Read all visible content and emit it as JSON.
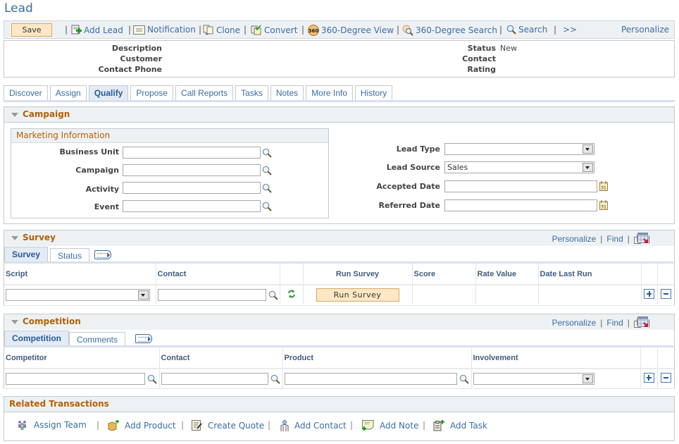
{
  "page_title": "Lead",
  "toolbar": {
    "save_label": "Save",
    "items": [
      {
        "label": "Add Lead",
        "icon": "add-lead-icon"
      },
      {
        "label": "Notification",
        "icon": "notification-icon"
      },
      {
        "label": "Clone",
        "icon": "clone-icon"
      },
      {
        "label": "Convert",
        "icon": "convert-icon"
      },
      {
        "label": "360-Degree View",
        "icon": "360-view-icon"
      },
      {
        "label": "360-Degree Search",
        "icon": "360-search-icon"
      },
      {
        "label": "Search",
        "icon": "search-icon"
      }
    ],
    "more_label": ">>",
    "personalize_label": "Personalize"
  },
  "header": {
    "description_label": "Description",
    "customer_label": "Customer",
    "contact_phone_label": "Contact Phone",
    "status_label": "Status",
    "status_value": "New",
    "contact_label": "Contact",
    "rating_label": "Rating"
  },
  "tabs": [
    {
      "label": "Discover",
      "active": false
    },
    {
      "label": "Assign",
      "active": false
    },
    {
      "label": "Qualify",
      "active": true
    },
    {
      "label": "Propose",
      "active": false
    },
    {
      "label": "Call Reports",
      "active": false
    },
    {
      "label": "Tasks",
      "active": false
    },
    {
      "label": "Notes",
      "active": false
    },
    {
      "label": "More Info",
      "active": false
    },
    {
      "label": "History",
      "active": false
    }
  ],
  "campaign": {
    "title": "Campaign",
    "marketing_title": "Marketing Information",
    "business_unit_label": "Business Unit",
    "business_unit_value": "",
    "campaign_label": "Campaign",
    "campaign_value": "",
    "activity_label": "Activity",
    "activity_value": "",
    "event_label": "Event",
    "event_value": "",
    "lead_type_label": "Lead Type",
    "lead_type_value": "",
    "lead_source_label": "Lead Source",
    "lead_source_value": "Sales",
    "accepted_date_label": "Accepted Date",
    "accepted_date_value": "",
    "referred_date_label": "Referred Date",
    "referred_date_value": ""
  },
  "survey": {
    "title": "Survey",
    "personalize_label": "Personalize",
    "find_label": "Find",
    "tabs": [
      "Survey",
      "Status"
    ],
    "columns": [
      "Script",
      "Contact",
      "",
      "Run Survey",
      "Score",
      "Rate Value",
      "Date Last Run"
    ],
    "row": {
      "script": "",
      "contact": "",
      "run_button_label": "Run Survey",
      "score": "",
      "rate_value": "",
      "date_last_run": ""
    }
  },
  "competition": {
    "title": "Competition",
    "personalize_label": "Personalize",
    "find_label": "Find",
    "tabs": [
      "Competition",
      "Comments"
    ],
    "columns": [
      "Competitor",
      "Contact",
      "Product",
      "Involvement"
    ],
    "row": {
      "competitor": "",
      "contact": "",
      "product": "",
      "involvement": ""
    }
  },
  "related": {
    "title": "Related Transactions",
    "items": [
      {
        "label": "Assign Team",
        "icon": "assign-team-icon"
      },
      {
        "label": "Add Product",
        "icon": "add-product-icon"
      },
      {
        "label": "Create Quote",
        "icon": "create-quote-icon"
      },
      {
        "label": "Add Contact",
        "icon": "add-contact-icon"
      },
      {
        "label": "Add Note",
        "icon": "add-note-icon"
      },
      {
        "label": "Add Task",
        "icon": "add-task-icon"
      }
    ]
  }
}
